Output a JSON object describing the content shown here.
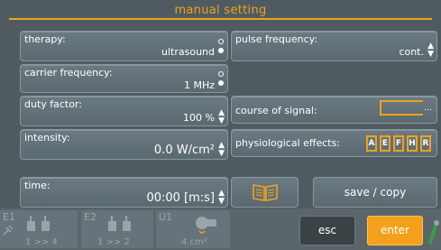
{
  "header": {
    "title": "manual setting"
  },
  "therapy": {
    "label": "therapy:",
    "value": "ultrasound"
  },
  "carrier_frequency": {
    "label": "carrier frequency:",
    "value": "1 MHz"
  },
  "duty_factor": {
    "label": "duty factor:",
    "value": "100 %"
  },
  "intensity": {
    "label": "intensity:",
    "value": "0.0 W/cm²"
  },
  "time": {
    "label": "time:",
    "value": "00:00 [m:s]"
  },
  "pulse_frequency": {
    "label": "pulse frequency:",
    "value": "cont."
  },
  "course_of_signal": {
    "label": "course of signal:",
    "more": "..."
  },
  "physiological_effects": {
    "label": "physiological effects:",
    "letters": [
      "A",
      "E",
      "F",
      "H",
      "R"
    ]
  },
  "actions": {
    "save_copy": "save / copy",
    "esc": "esc",
    "enter": "enter"
  },
  "channels": [
    {
      "id": "E1",
      "value": "1 >> 4"
    },
    {
      "id": "E2",
      "value": "1 >> 2"
    },
    {
      "id": "U1",
      "value": "4 cm²"
    }
  ],
  "colors": {
    "accent": "#f0a11e",
    "background": "#4f5b61",
    "panel": "#63717a",
    "enter": "#f5a01c",
    "esc": "#3a4246"
  },
  "icons": {
    "manual": "book-icon",
    "electrode": "electrode-icon",
    "ultrasound_head": "ultrasound-head-icon"
  }
}
